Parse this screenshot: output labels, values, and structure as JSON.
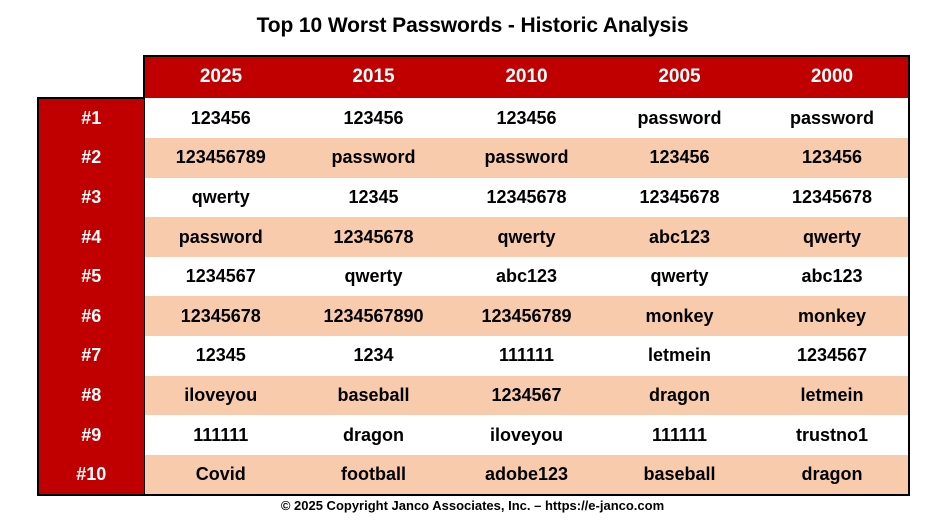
{
  "title": "Top 10 Worst Passwords - Historic Analysis",
  "colors": {
    "header_red": "#C00000",
    "alt_row_peach": "#F8CBAD",
    "row_white": "#FFFFFF",
    "border_black": "#000000",
    "text_black": "#000000",
    "header_text_white": "#FFFFFF"
  },
  "table": {
    "corner_label": "",
    "columns": [
      "2025",
      "2015",
      "2010",
      "2005",
      "2000"
    ],
    "ranks": [
      "#1",
      "#2",
      "#3",
      "#4",
      "#5",
      "#6",
      "#7",
      "#8",
      "#9",
      "#10"
    ],
    "rows": [
      [
        "123456",
        "123456",
        "123456",
        "password",
        "password"
      ],
      [
        "123456789",
        "password",
        "password",
        "123456",
        "123456"
      ],
      [
        "qwerty",
        "12345",
        "12345678",
        "12345678",
        "12345678"
      ],
      [
        "password",
        "12345678",
        "qwerty",
        "abc123",
        "qwerty"
      ],
      [
        "1234567",
        "qwerty",
        "abc123",
        "qwerty",
        "abc123"
      ],
      [
        "12345678",
        "1234567890",
        "123456789",
        "monkey",
        "monkey"
      ],
      [
        "12345",
        "1234",
        "111111",
        "letmein",
        "1234567"
      ],
      [
        "iloveyou",
        "baseball",
        "1234567",
        "dragon",
        "letmein"
      ],
      [
        "111111",
        "dragon",
        "iloveyou",
        "111111",
        "trustno1"
      ],
      [
        "Covid",
        "football",
        "adobe123",
        "baseball",
        "dragon"
      ]
    ]
  },
  "footer": "© 2025 Copyright Janco Associates, Inc. – https://e-janco.com"
}
